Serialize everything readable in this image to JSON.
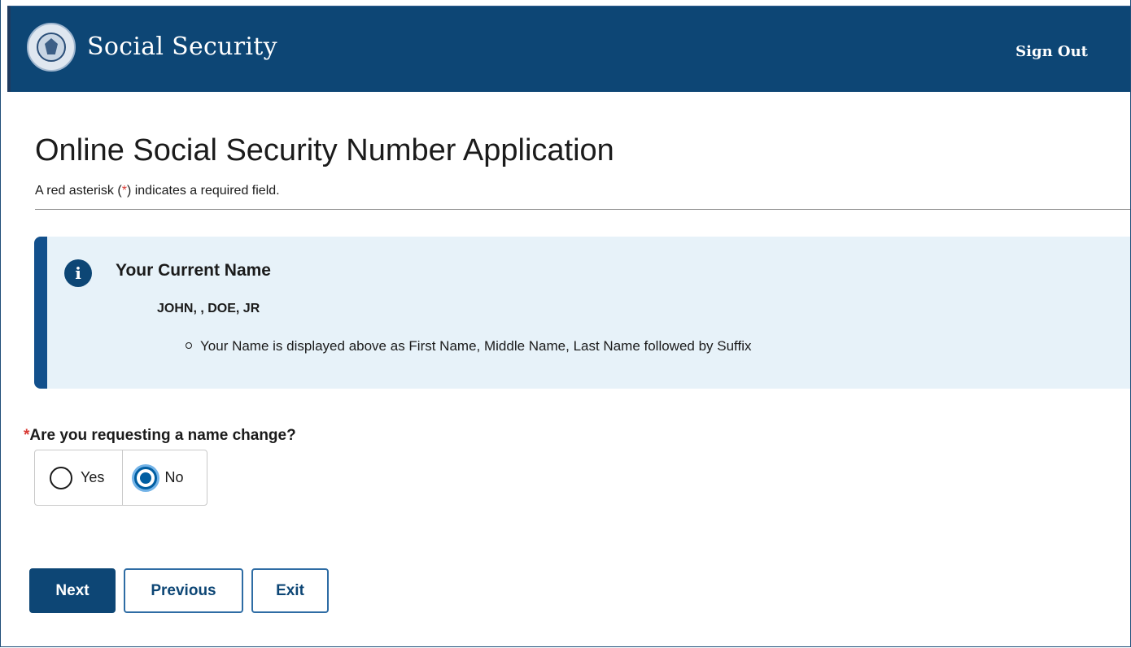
{
  "header": {
    "brand": "Social Security",
    "sign_out": "Sign Out"
  },
  "main": {
    "title": "Online Social Security Number Application",
    "required_note_prefix": "A red asterisk (",
    "required_note_asterisk": "*",
    "required_note_suffix": ") indicates a required field."
  },
  "alert": {
    "heading": "Your Current Name",
    "name": "JOHN, , DOE, JR",
    "bullet": "Your Name is displayed above as First Name, Middle Name, Last Name followed by Suffix"
  },
  "question": {
    "asterisk": "*",
    "label": "Are you requesting a name change?",
    "options": [
      {
        "label": "Yes",
        "selected": false
      },
      {
        "label": "No",
        "selected": true
      }
    ]
  },
  "buttons": {
    "next": "Next",
    "previous": "Previous",
    "exit": "Exit"
  },
  "colors": {
    "header_bg": "#0d4675",
    "alert_bg": "#e7f2f9",
    "alert_border": "#12508c",
    "required_red": "#d83933",
    "radio_selected": "#005ea2"
  },
  "icons": {
    "logo": "ssa-seal-icon",
    "alert": "info-icon"
  }
}
